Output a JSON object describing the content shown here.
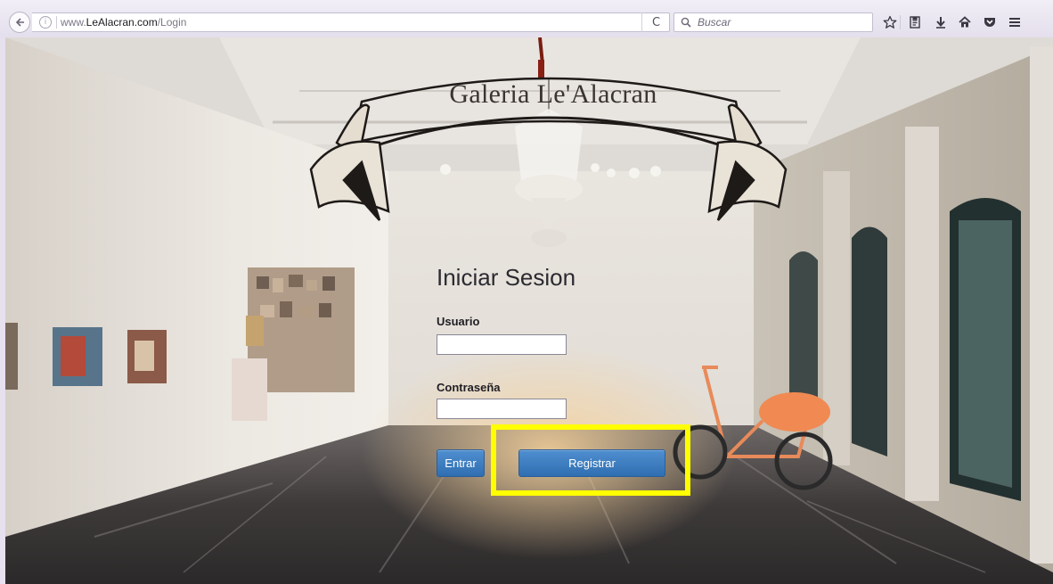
{
  "browser": {
    "url_prefix": "www.",
    "url_host": "LeAlacran.com",
    "url_path": "/Login",
    "search_placeholder": "Buscar"
  },
  "page": {
    "banner_title": "Galeria Le'Alacran",
    "login_title": "Iniciar Sesion",
    "username_label": "Usuario",
    "username_value": "",
    "password_label": "Contraseña",
    "password_value": "",
    "login_button": "Entrar",
    "register_button": "Registrar"
  },
  "colors": {
    "button_blue": "#3a7cc0",
    "highlight": "#ffff00"
  }
}
